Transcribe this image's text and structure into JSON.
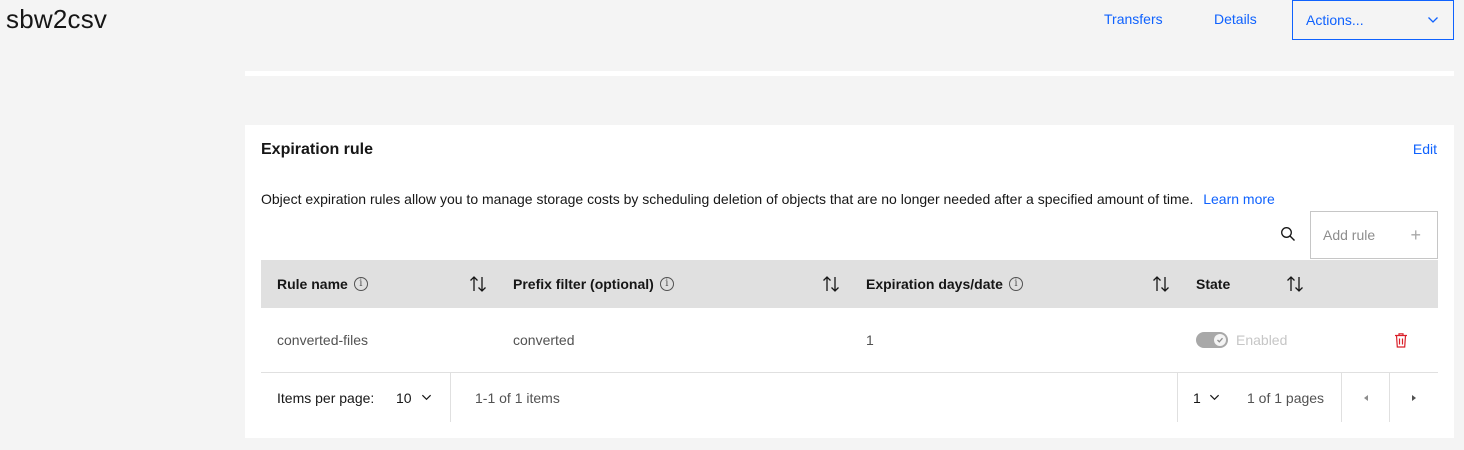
{
  "header": {
    "title": "sbw2csv",
    "transfers_label": "Transfers",
    "details_label": "Details",
    "actions_label": "Actions..."
  },
  "expiration": {
    "title": "Expiration rule",
    "edit_label": "Edit",
    "description": "Object expiration rules allow you to manage storage costs by scheduling deletion of objects that are no longer needed after a specified amount of time.",
    "learn_more": "Learn more",
    "add_rule_label": "Add rule",
    "add_rule_icon": "+",
    "columns": {
      "rule_name": "Rule name",
      "prefix_filter": "Prefix filter (optional)",
      "expiration": "Expiration days/date",
      "state": "State"
    },
    "rows": [
      {
        "rule_name": "converted-files",
        "prefix_filter": "converted",
        "expiration": "1",
        "state": "Enabled"
      }
    ],
    "pagination": {
      "items_per_page_label": "Items per page:",
      "items_per_page_value": "10",
      "range_text": "1-1 of 1 items",
      "page_value": "1",
      "pages_text": "1 of 1 pages"
    }
  },
  "colors": {
    "accent": "#0f62fe",
    "danger": "#da1e28",
    "page_bg": "#f4f4f4",
    "header_bg": "#e0e0e0"
  }
}
